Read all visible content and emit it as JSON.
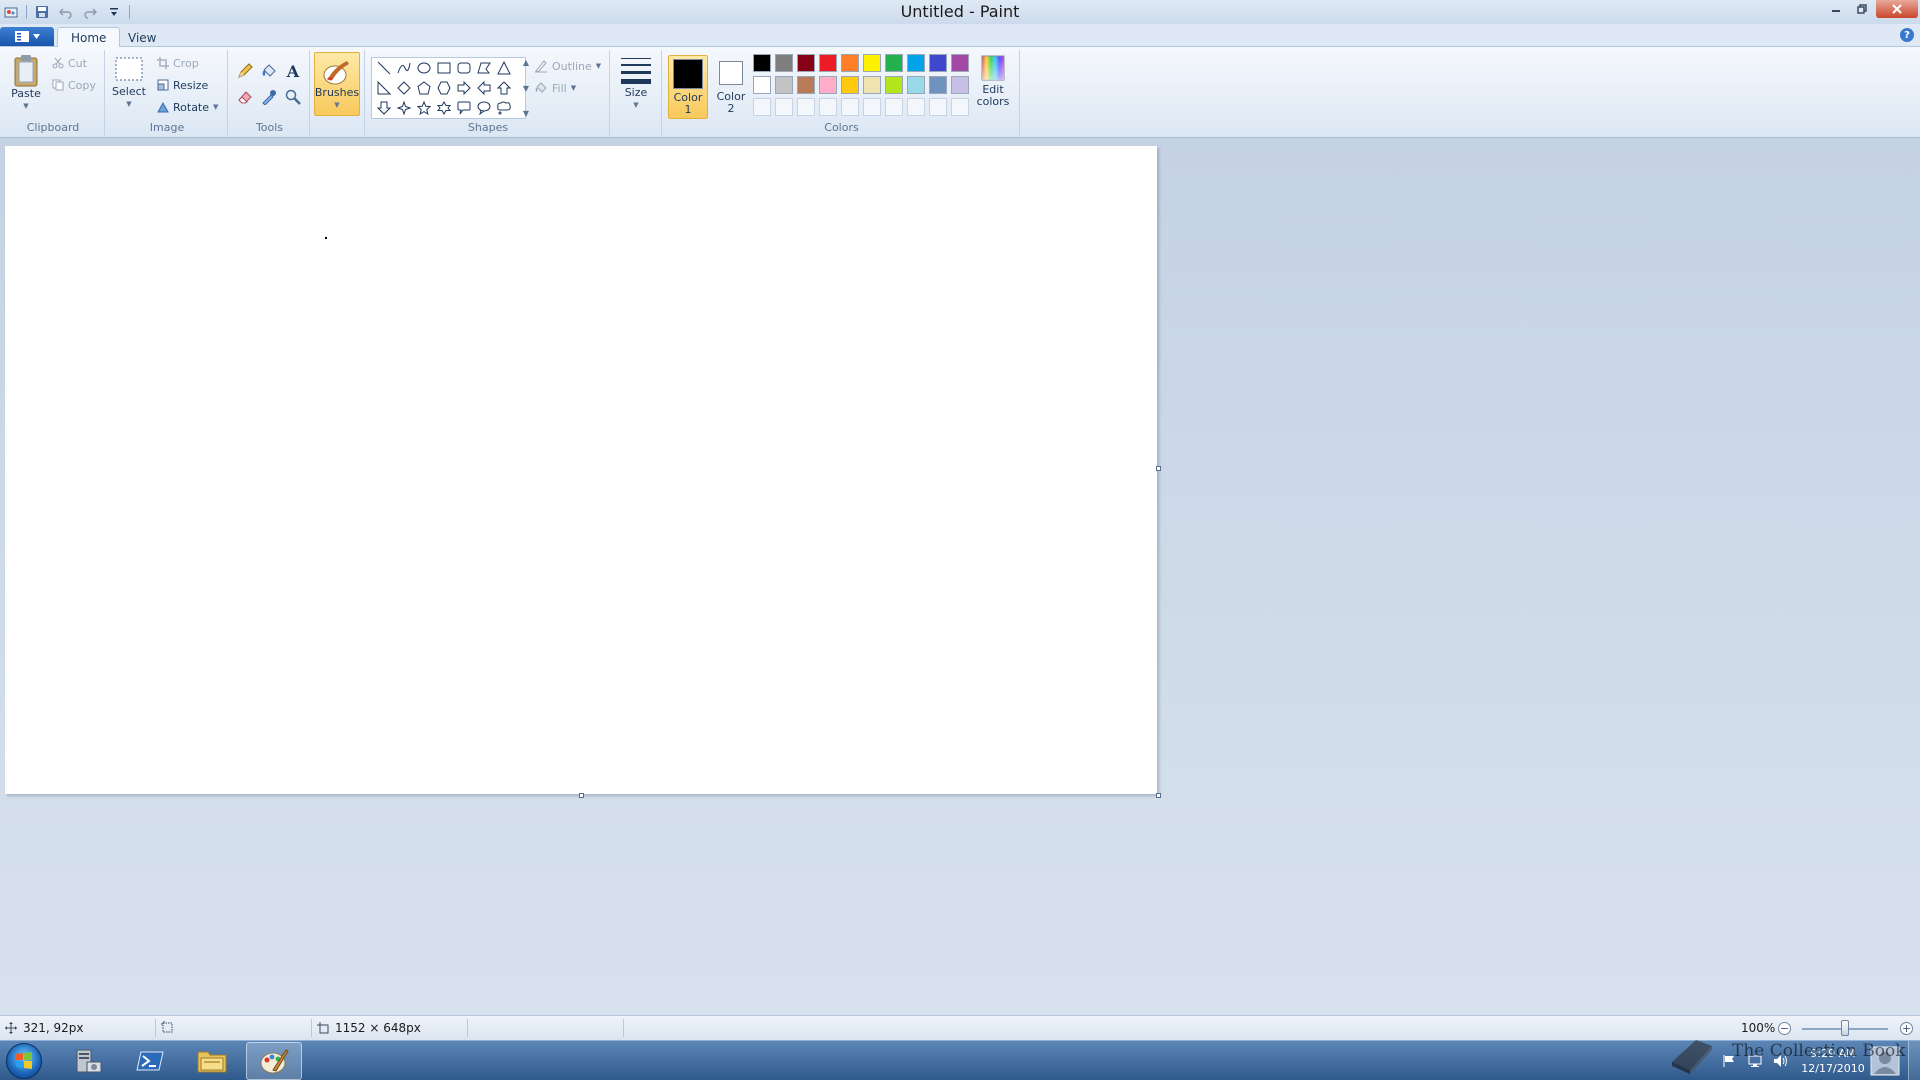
{
  "window": {
    "title": "Untitled - Paint"
  },
  "tabs": {
    "home": "Home",
    "view": "View"
  },
  "clipboard": {
    "paste": "Paste",
    "cut": "Cut",
    "copy": "Copy",
    "group_label": "Clipboard"
  },
  "image": {
    "select": "Select",
    "crop": "Crop",
    "resize": "Resize",
    "rotate": "Rotate",
    "group_label": "Image"
  },
  "tools": {
    "group_label": "Tools",
    "items": [
      "pencil-icon",
      "fill-bucket-icon",
      "text-icon",
      "eraser-icon",
      "color-picker-icon",
      "magnifier-icon"
    ]
  },
  "brushes": {
    "label": "Brushes"
  },
  "shapes": {
    "outline": "Outline",
    "fill": "Fill",
    "group_label": "Shapes",
    "items": [
      "line-shape-icon",
      "curve-shape-icon",
      "oval-shape-icon",
      "rectangle-shape-icon",
      "rounded-rectangle-shape-icon",
      "polygon-shape-icon",
      "triangle-shape-icon",
      "right-triangle-shape-icon",
      "diamond-shape-icon",
      "pentagon-shape-icon",
      "hexagon-shape-icon",
      "right-arrow-shape-icon",
      "left-arrow-shape-icon",
      "up-arrow-shape-icon",
      "down-arrow-shape-icon",
      "four-point-star-shape-icon",
      "five-point-star-shape-icon",
      "six-point-star-shape-icon",
      "rounded-callout-shape-icon",
      "oval-callout-shape-icon",
      "cloud-callout-shape-icon"
    ]
  },
  "size": {
    "label": "Size"
  },
  "colors": {
    "color1_line1": "Color",
    "color1_line2": "1",
    "color2_line1": "Color",
    "color2_line2": "2",
    "edit_line1": "Edit",
    "edit_line2": "colors",
    "group_label": "Colors",
    "color1_value": "#000000",
    "color2_value": "#ffffff",
    "palette_row1": [
      "#000000",
      "#7f7f7f",
      "#880015",
      "#ed1c24",
      "#ff7f27",
      "#fff200",
      "#22b14c",
      "#00a2e8",
      "#3f48cc",
      "#a349a4"
    ],
    "palette_row2": [
      "#ffffff",
      "#c3c3c3",
      "#b97a57",
      "#ffaec9",
      "#ffc90e",
      "#efe4b0",
      "#b5e61d",
      "#99d9ea",
      "#7092be",
      "#c8bfe7"
    ]
  },
  "status": {
    "cursor_pos": "321, 92px",
    "image_size": "1152 × 648px",
    "zoom": "100%",
    "zoom_level": 1.0
  },
  "taskbar": {
    "time": "9:29 AM",
    "date": "12/17/2010",
    "apps": [
      "start-orb",
      "server-manager-icon",
      "powershell-icon",
      "file-explorer-icon",
      "paint-app-icon"
    ]
  },
  "watermark": {
    "text": "The Collection Book"
  }
}
